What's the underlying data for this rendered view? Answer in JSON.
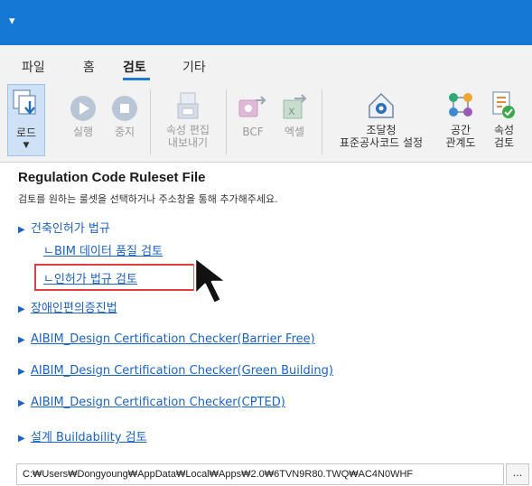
{
  "titlebar": {
    "quick_access": "▾"
  },
  "menu": {
    "items": [
      "파일",
      "홈",
      "검토",
      "기타"
    ],
    "active": "검토"
  },
  "ribbon": {
    "load": {
      "label": "로드"
    },
    "run": {
      "label": "실행"
    },
    "stop": {
      "label": "중지"
    },
    "property_edit": {
      "line1": "속성 편집",
      "line2": "내보내기"
    },
    "bcf": {
      "label": "BCF"
    },
    "excel": {
      "label": "엑셀"
    },
    "procurement": {
      "line1": "조달청",
      "line2": "표준공사코드 설정"
    },
    "space": {
      "line1": "공간",
      "line2": "관계도"
    },
    "attribute": {
      "line1": "속성",
      "line2": "검토"
    }
  },
  "panel": {
    "title": "Regulation Code Ruleset File",
    "subtitle": "검토를 원하는 룰셋을 선택하거나 주소창을 통해 추가해주세요.",
    "groups": [
      {
        "label": "건축인허가 법규"
      },
      {
        "label": "장애인편의증진법"
      },
      {
        "label": "AIBIM_Design Certification Checker(Barrier Free)"
      },
      {
        "label": "AIBIM_Design Certification Checker(Green Building)"
      },
      {
        "label": "AIBIM_Design Certification Checker(CPTED)"
      },
      {
        "label": "설계 Buildability 검토"
      }
    ],
    "children": [
      {
        "label": "ㄴBIM 데이터 품질 검토"
      },
      {
        "label": "ㄴ인허가 법규 검토"
      }
    ],
    "path_value": "C:₩Users₩Dongyoung₩AppData₩Local₩Apps₩2.0₩6TVN9R80.TWQ₩AC4N0WHF",
    "browse_label": "..."
  },
  "colors": {
    "titlebar": "#1478d4",
    "link": "#1a63c6",
    "highlight": "#e23c3c",
    "accent": "#1a7bd0"
  }
}
